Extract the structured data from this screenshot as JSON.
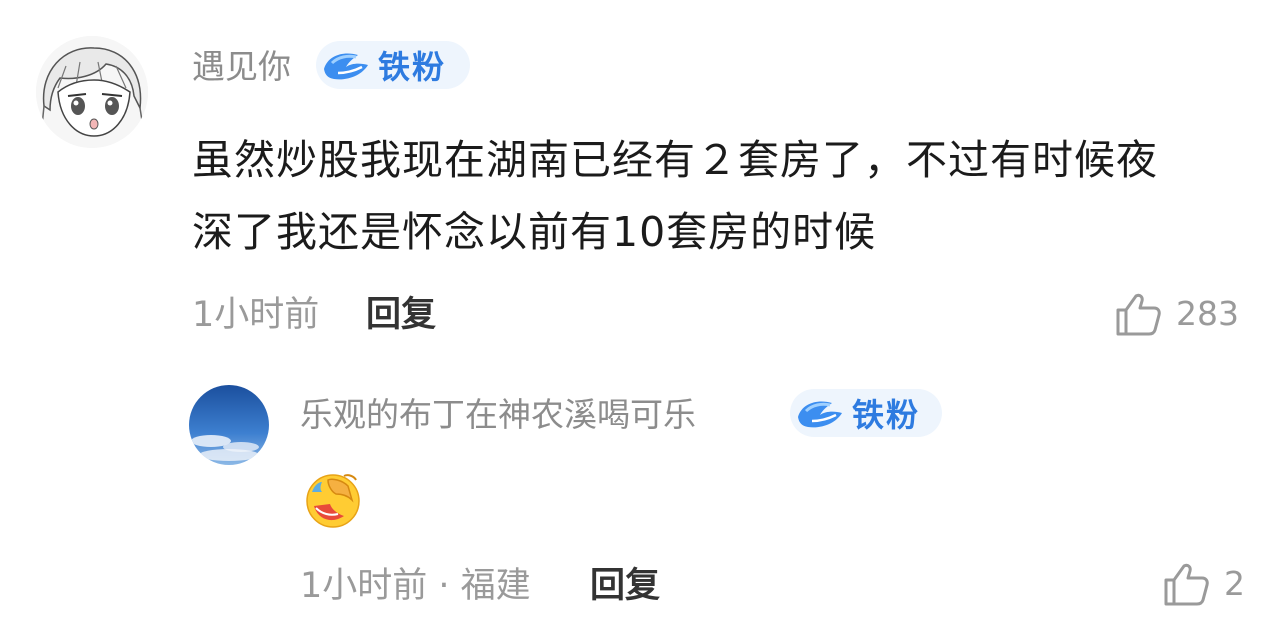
{
  "colors": {
    "accent": "#2e7be0",
    "badge_bg": "#eef5fd",
    "text_main": "#1b1b1b",
    "text_secondary": "#9a9a9a"
  },
  "comment": {
    "avatar_icon": "anime-girl-avatar",
    "username": "遇见你",
    "badge_icon": "fan-bird-icon",
    "badge_label": "铁粉",
    "text_line1": "虽然炒股我现在湖南已经有２套房了，不过有时候夜",
    "text_line2": "深了我还是怀念以前有10套房的时候",
    "time": "1小时前",
    "reply_label": "回复",
    "like_icon": "thumbs-up-icon",
    "like_count": "283"
  },
  "reply": {
    "avatar_icon": "sky-avatar",
    "username": "乐观的布丁在神农溪喝可乐",
    "badge_icon": "fan-bird-icon",
    "badge_label": "铁粉",
    "emoji": "facepalm-laugh-emoji",
    "time_location": "1小时前 · 福建",
    "reply_label": "回复",
    "like_icon": "thumbs-up-icon",
    "like_count": "2"
  }
}
